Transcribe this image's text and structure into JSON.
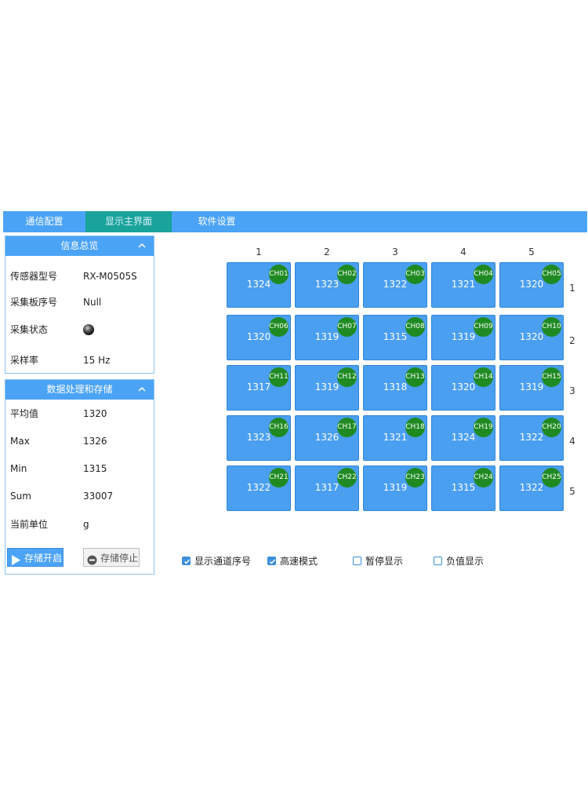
{
  "tabs": [
    "通信配置",
    "显示主界面",
    "软件设置"
  ],
  "info_panel": {
    "title": "信息总览",
    "rows": [
      {
        "label": "传感器型号",
        "value": "RX-M0505S"
      },
      {
        "label": "采集板序号",
        "value": "Null"
      },
      {
        "label": "采集状态",
        "value": ""
      },
      {
        "label": "采样率",
        "value": "15 Hz"
      }
    ]
  },
  "proc_panel": {
    "title": "数据处理和存储",
    "rows": [
      {
        "label": "平均值",
        "value": "1320"
      },
      {
        "label": "Max",
        "value": "1326"
      },
      {
        "label": "Min",
        "value": "1315"
      },
      {
        "label": "Sum",
        "value": "33007"
      },
      {
        "label": "当前单位",
        "value": "g"
      }
    ],
    "start_button": "存储开启",
    "stop_button": "存储停止"
  },
  "grid": {
    "col_labels": [
      "1",
      "2",
      "3",
      "4",
      "5"
    ],
    "row_labels": [
      "1",
      "2",
      "3",
      "4",
      "5"
    ],
    "channels": [
      {
        "ch": "CH01",
        "value": "1324"
      },
      {
        "ch": "CH02",
        "value": "1323"
      },
      {
        "ch": "CH03",
        "value": "1322"
      },
      {
        "ch": "CH04",
        "value": "1321"
      },
      {
        "ch": "CH05",
        "value": "1320"
      },
      {
        "ch": "CH06",
        "value": "1320"
      },
      {
        "ch": "CH07",
        "value": "1319"
      },
      {
        "ch": "CH08",
        "value": "1315"
      },
      {
        "ch": "CH09",
        "value": "1319"
      },
      {
        "ch": "CH10",
        "value": "1320"
      },
      {
        "ch": "CH11",
        "value": "1317"
      },
      {
        "ch": "CH12",
        "value": "1319"
      },
      {
        "ch": "CH13",
        "value": "1318"
      },
      {
        "ch": "CH14",
        "value": "1320"
      },
      {
        "ch": "CH15",
        "value": "1319"
      },
      {
        "ch": "CH16",
        "value": "1323"
      },
      {
        "ch": "CH17",
        "value": "1326"
      },
      {
        "ch": "CH18",
        "value": "1321"
      },
      {
        "ch": "CH19",
        "value": "1324"
      },
      {
        "ch": "CH20",
        "value": "1322"
      },
      {
        "ch": "CH21",
        "value": "1322"
      },
      {
        "ch": "CH22",
        "value": "1317"
      },
      {
        "ch": "CH23",
        "value": "1319"
      },
      {
        "ch": "CH24",
        "value": "1315"
      },
      {
        "ch": "CH25",
        "value": "1322"
      }
    ]
  },
  "options": [
    {
      "label": "显示通道序号",
      "checked": true
    },
    {
      "label": "高速模式",
      "checked": true
    },
    {
      "label": "暂停显示",
      "checked": false
    },
    {
      "label": "负值显示",
      "checked": false
    }
  ],
  "colors": {
    "tab_bar": "#4ba3f5",
    "active_tab": "#1aa39a",
    "cell": "#4a9ff0",
    "channel_badge": "#1f8a22"
  }
}
